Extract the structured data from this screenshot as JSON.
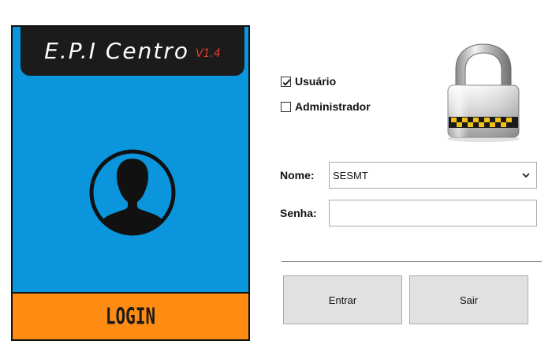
{
  "app": {
    "title": "E.P.I Centro",
    "version": "V1.4"
  },
  "left_panel": {
    "login_label": "LOGIN",
    "avatar_icon": "user-avatar-icon",
    "colors": {
      "panel": "#0a95dc",
      "banner": "#1b1b1b",
      "login_bar": "#ff8c12",
      "version": "#e53b30"
    }
  },
  "options": {
    "user": {
      "label": "Usuário",
      "checked": true
    },
    "admin": {
      "label": "Administrador",
      "checked": false
    }
  },
  "form": {
    "nome_label": "Nome:",
    "nome_value": "SESMT",
    "senha_label": "Senha:",
    "senha_value": ""
  },
  "buttons": {
    "entrar": "Entrar",
    "sair": "Sair"
  },
  "icons": {
    "lock": "padlock-icon",
    "dropdown": "chevron-down-icon",
    "checkmark": "checkmark-icon"
  }
}
